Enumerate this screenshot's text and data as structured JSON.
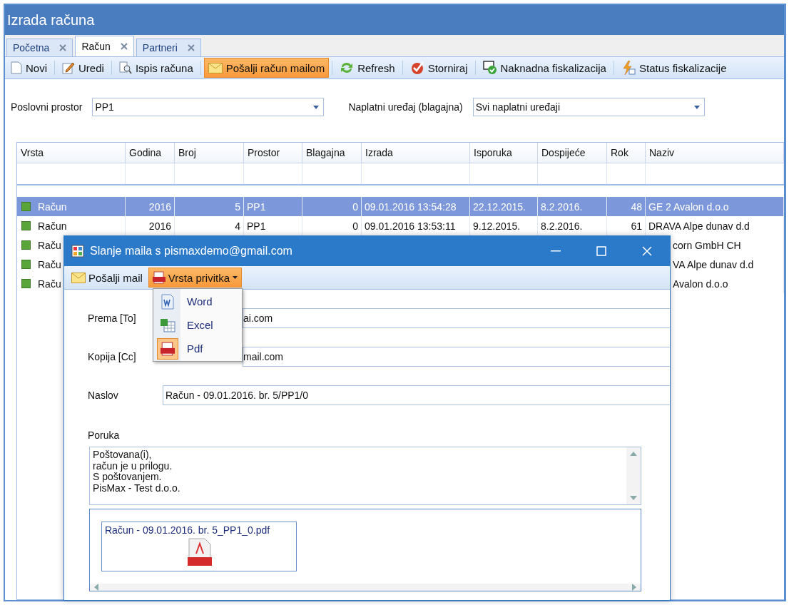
{
  "window": {
    "title": "Izrada računa"
  },
  "tabs": [
    {
      "label": "Početna",
      "selected": false
    },
    {
      "label": "Račun",
      "selected": true
    },
    {
      "label": "Partneri",
      "selected": false
    }
  ],
  "toolbar": [
    {
      "label": "Novi",
      "selected": false
    },
    {
      "label": "Uredi",
      "selected": false
    },
    {
      "label": "Ispis računa",
      "selected": false
    },
    {
      "label": "Pošalji račun mailom",
      "selected": true
    },
    {
      "label": "Refresh",
      "selected": false
    },
    {
      "label": "Storniraj",
      "selected": false
    },
    {
      "label": "Naknadna fiskalizacija",
      "selected": false
    },
    {
      "label": "Status fiskalizacije",
      "selected": false
    }
  ],
  "filters": [
    {
      "label": "Poslovni prostor",
      "value": "PP1"
    },
    {
      "label": "Naplatni uređaj (blagajna)",
      "value": "Svi naplatni uređaji"
    }
  ],
  "table": {
    "columns": [
      "Vrsta",
      "Godina",
      "Broj",
      "Prostor",
      "Blagajna",
      "Izrada",
      "Isporuka",
      "Dospijeće",
      "Rok",
      "Naziv"
    ],
    "rows": [
      {
        "selected": true,
        "vrsta": "Račun",
        "values": [
          "2016",
          "5",
          "PP1",
          "0",
          "09.01.2016 13:54:28",
          "22.12.2015.",
          "8.2.2016.",
          "48"
        ],
        "naziv": "GE 2 Avalon d.o.o"
      },
      {
        "selected": false,
        "vrsta": "Račun",
        "values": [
          "2016",
          "4",
          "PP1",
          "0",
          "09.01.2016 13:53:11",
          "9.12.2015.",
          "8.2.2016.",
          "61"
        ],
        "naziv": "DRAVA Alpe dunav d.d"
      },
      {
        "selected": false,
        "vrsta": "Raču",
        "naziv": "corn GmbH CH"
      },
      {
        "selected": false,
        "vrsta": "Raču",
        "naziv": "VA Alpe dunav d.d"
      },
      {
        "selected": false,
        "vrsta": "Raču",
        "naziv": "Avalon d.o.o"
      }
    ]
  },
  "dialog": {
    "title": "Slanje maila s pismaxdemo@gmail.com",
    "toolbar": [
      {
        "label": "Pošalji mail",
        "selected": false,
        "dropdown": false
      },
      {
        "label": "Vrsta privitka",
        "selected": true,
        "dropdown": true
      }
    ],
    "menu": [
      {
        "label": "Word",
        "selected": false
      },
      {
        "label": "Excel",
        "selected": false
      },
      {
        "label": "Pdf",
        "selected": true
      }
    ],
    "fields": [
      {
        "label": "Prema [To]",
        "value": "ai.com",
        "covered": true
      },
      {
        "label": "Kopija [Cc]",
        "value": "mail.com",
        "covered": true
      },
      {
        "label": "Naslov",
        "value": "Račun - 09.01.2016. br. 5/PP1/0",
        "covered": false
      }
    ],
    "message": {
      "label": "Poruka",
      "value": "Poštovana(i),\nračun je u prilogu.\nS poštovanjem.\nPisMax - Test d.o.o."
    },
    "attachments": [
      {
        "name": "Račun - 09.01.2016. br. 5_PP1_0.pdf"
      }
    ]
  }
}
